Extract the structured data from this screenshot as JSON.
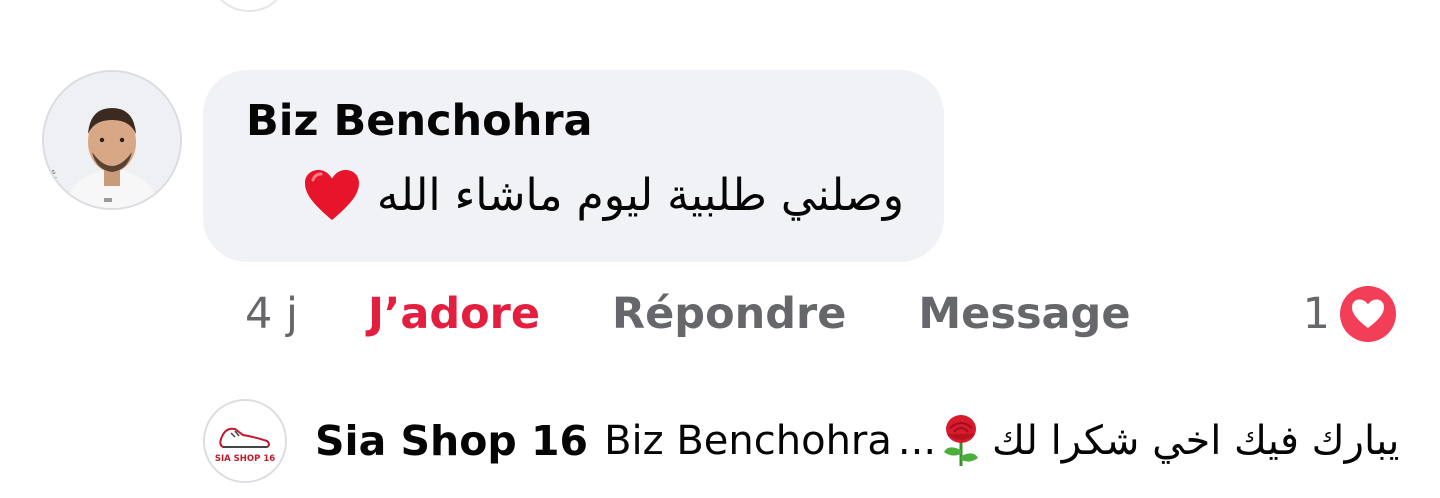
{
  "comment": {
    "author": "Biz Benchohra",
    "text": "وصلني طلبية ليوم ماشاء الله",
    "emoji_icon": "red-heart-icon"
  },
  "actions": {
    "time": "4 j",
    "love_label": "J’adore",
    "reply_label": "Répondre",
    "message_label": "Message"
  },
  "reactions": {
    "count": "1",
    "icon": "love-reaction-icon"
  },
  "reply": {
    "author": "Sia Shop 16",
    "avatar_text": "SIA SHOP 16",
    "mention": "Biz Benchohra",
    "ellipsis": "...",
    "emoji_icon": "rose-icon",
    "text": "يبارك فيك اخي شكرا لك"
  },
  "colors": {
    "accent_love": "#e41e3f",
    "bubble_bg": "#f0f2f5",
    "muted_text": "#65676b",
    "primary_text": "#050505"
  }
}
